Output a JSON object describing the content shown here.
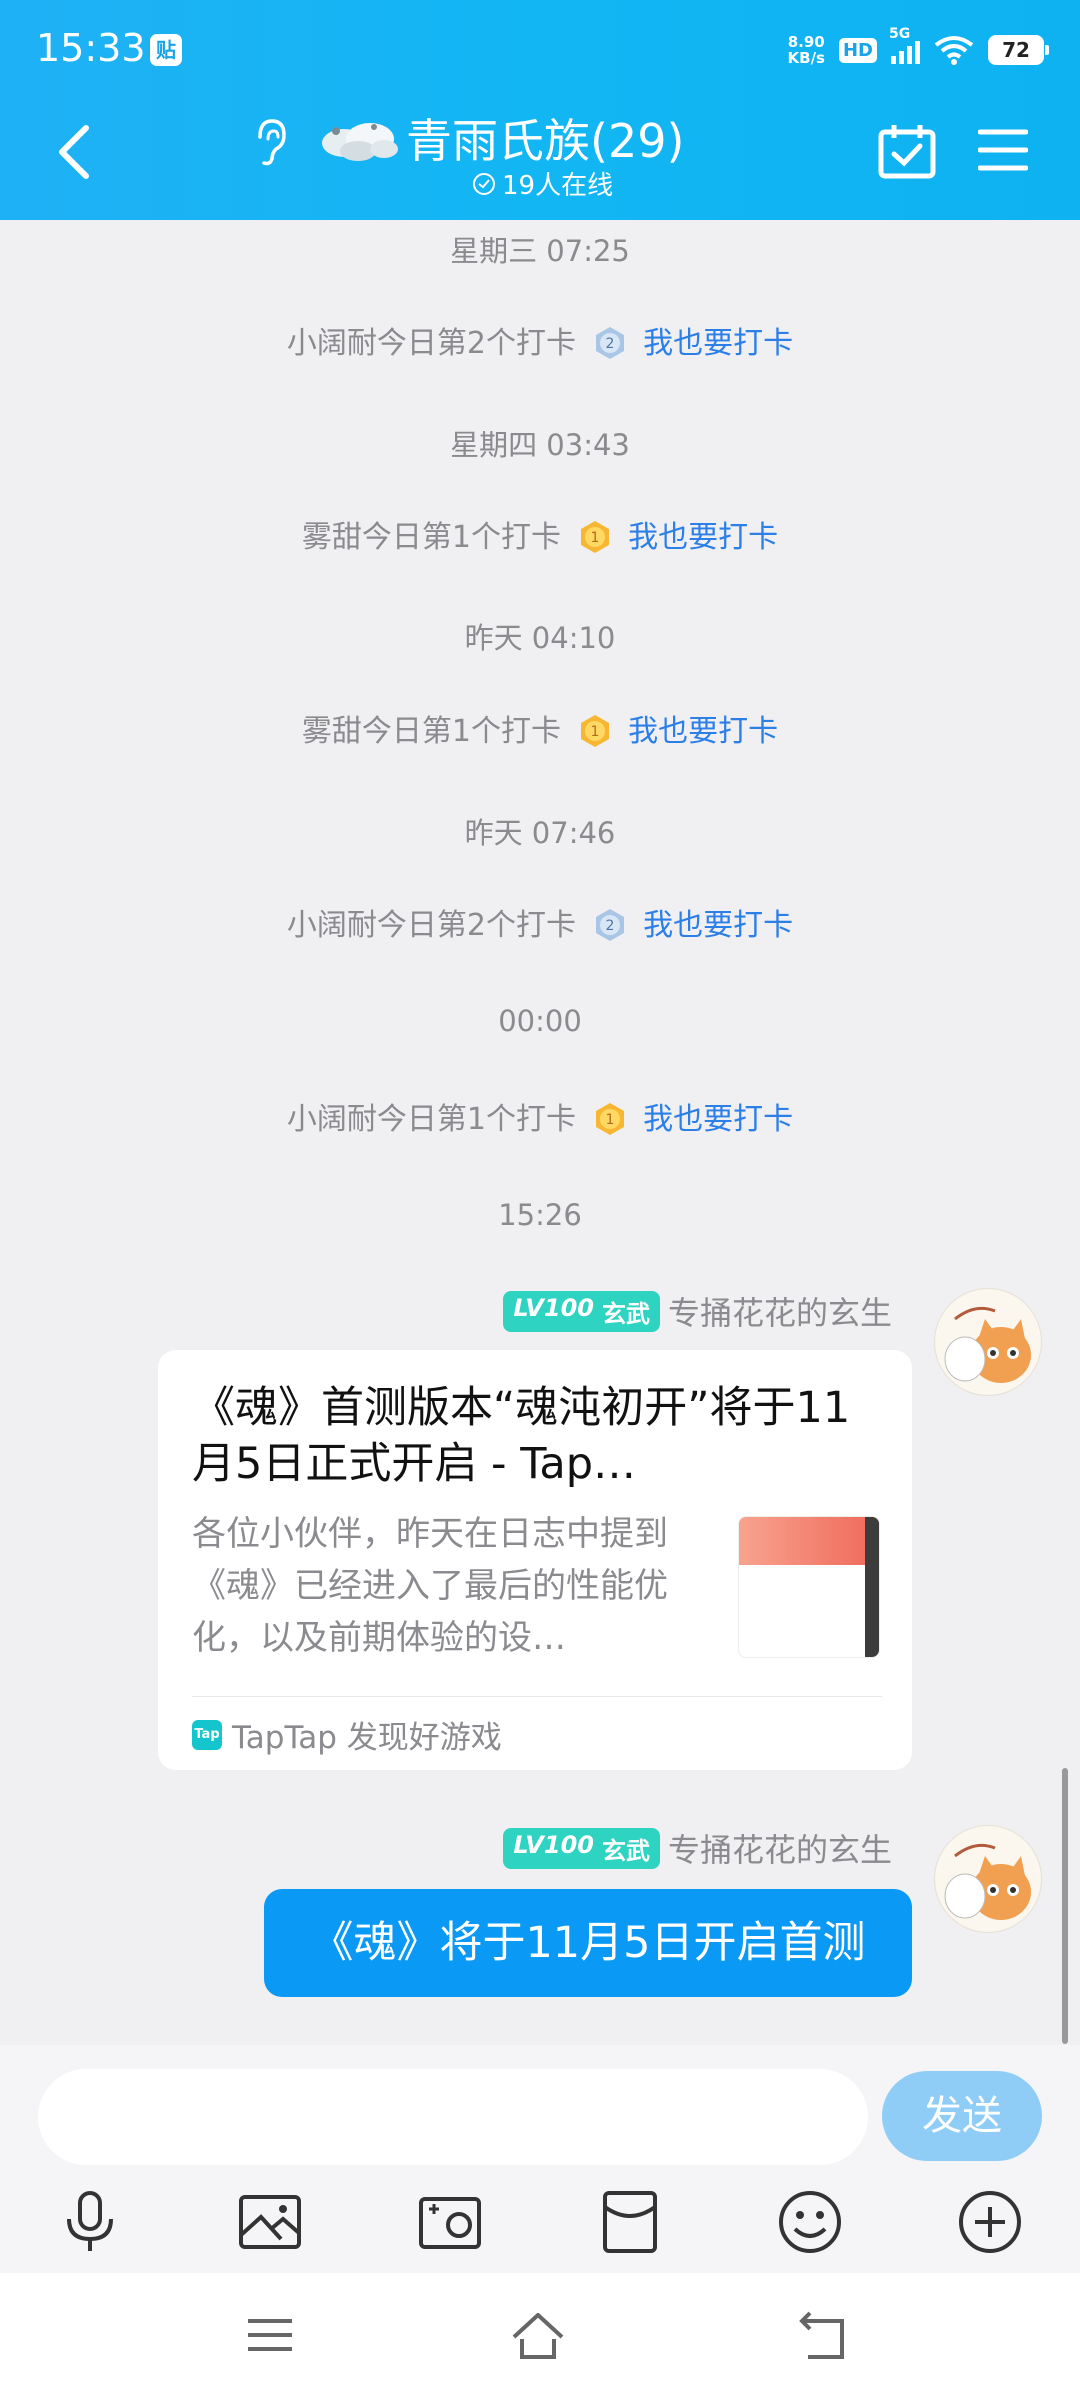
{
  "status_bar": {
    "time": "15:33",
    "app_badge": "贴",
    "net_speed_value": "8.90",
    "net_speed_unit": "KB/s",
    "hd": "HD",
    "network": "5G",
    "battery": "72"
  },
  "header": {
    "title": "青雨氏族(29)",
    "online": "19人在线"
  },
  "messages": {
    "t1": "星期三 07:25",
    "c1": {
      "text": "小阔耐今日第2个打卡",
      "rank": "2",
      "link": "我也要打卡"
    },
    "t2": "星期四 03:43",
    "c2": {
      "text": "雾甜今日第1个打卡",
      "rank": "1",
      "link": "我也要打卡"
    },
    "t3": "昨天 04:10",
    "c3": {
      "text": "雾甜今日第1个打卡",
      "rank": "1",
      "link": "我也要打卡"
    },
    "t4": "昨天 07:46",
    "c4": {
      "text": "小阔耐今日第2个打卡",
      "rank": "2",
      "link": "我也要打卡"
    },
    "t5": "00:00",
    "c5": {
      "text": "小阔耐今日第1个打卡",
      "rank": "1",
      "link": "我也要打卡"
    },
    "t6": "15:26"
  },
  "sender": {
    "level": "LV100",
    "rank": "玄武",
    "name": "专捅花花的玄生"
  },
  "share_card": {
    "title": "《魂》首测版本“魂沌初开”将于11月5日正式开启 - Tap…",
    "desc": "各位小伙伴，昨天在日志中提到《魂》已经进入了最后的性能优化，以及前期体验的设…",
    "source_icon": "Tap",
    "source": "TapTap 发现好游戏"
  },
  "bubble": {
    "text": "《魂》将于11月5日开启首测"
  },
  "input": {
    "placeholder": "",
    "send": "发送"
  },
  "colors": {
    "header": "#12b6f3",
    "bubble": "#0a99f5",
    "link": "#2d7fe8",
    "level_badge": "#2fd3c2"
  },
  "icons": {
    "toolbar": [
      "microphone-icon",
      "image-icon",
      "camera-icon",
      "red-packet-icon",
      "emoji-icon",
      "plus-icon"
    ],
    "nav": [
      "menu-icon",
      "home-icon",
      "back-icon"
    ]
  }
}
